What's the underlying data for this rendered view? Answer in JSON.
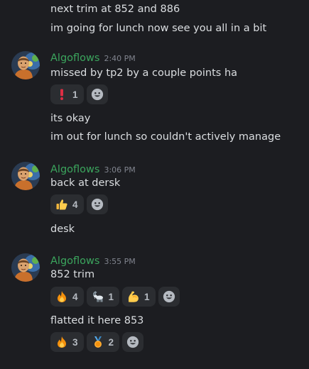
{
  "messages": {
    "lines": [
      "next trim at 852 and 886",
      "im going for lunch now see you all in a bit",
      "missed by tp2 by a couple points ha",
      "its okay",
      "im out for lunch so couldn't actively manage",
      "back at dersk",
      "desk",
      "852 trim",
      "flatted it here 853"
    ]
  },
  "groups": [
    {
      "username": "Algoflows",
      "time": "2:40 PM"
    },
    {
      "username": "Algoflows",
      "time": "3:06 PM"
    },
    {
      "username": "Algoflows",
      "time": "3:55 PM"
    }
  ],
  "reactions": {
    "r1": [
      {
        "emoji": "exclamation",
        "count": "1"
      }
    ],
    "r2": [
      {
        "emoji": "thumbs-up",
        "count": "4"
      }
    ],
    "r3": [
      {
        "emoji": "fire",
        "count": "4"
      },
      {
        "emoji": "goat",
        "count": "1"
      },
      {
        "emoji": "flexed-biceps",
        "count": "1"
      }
    ],
    "r4": [
      {
        "emoji": "fire",
        "count": "3"
      },
      {
        "emoji": "medal",
        "count": "2"
      }
    ]
  },
  "colors": {
    "background": "#1c1d21",
    "username": "#3ba55d",
    "text": "#dbdee1",
    "timestamp": "#80848e",
    "reaction_bg": "#2b2d31"
  }
}
